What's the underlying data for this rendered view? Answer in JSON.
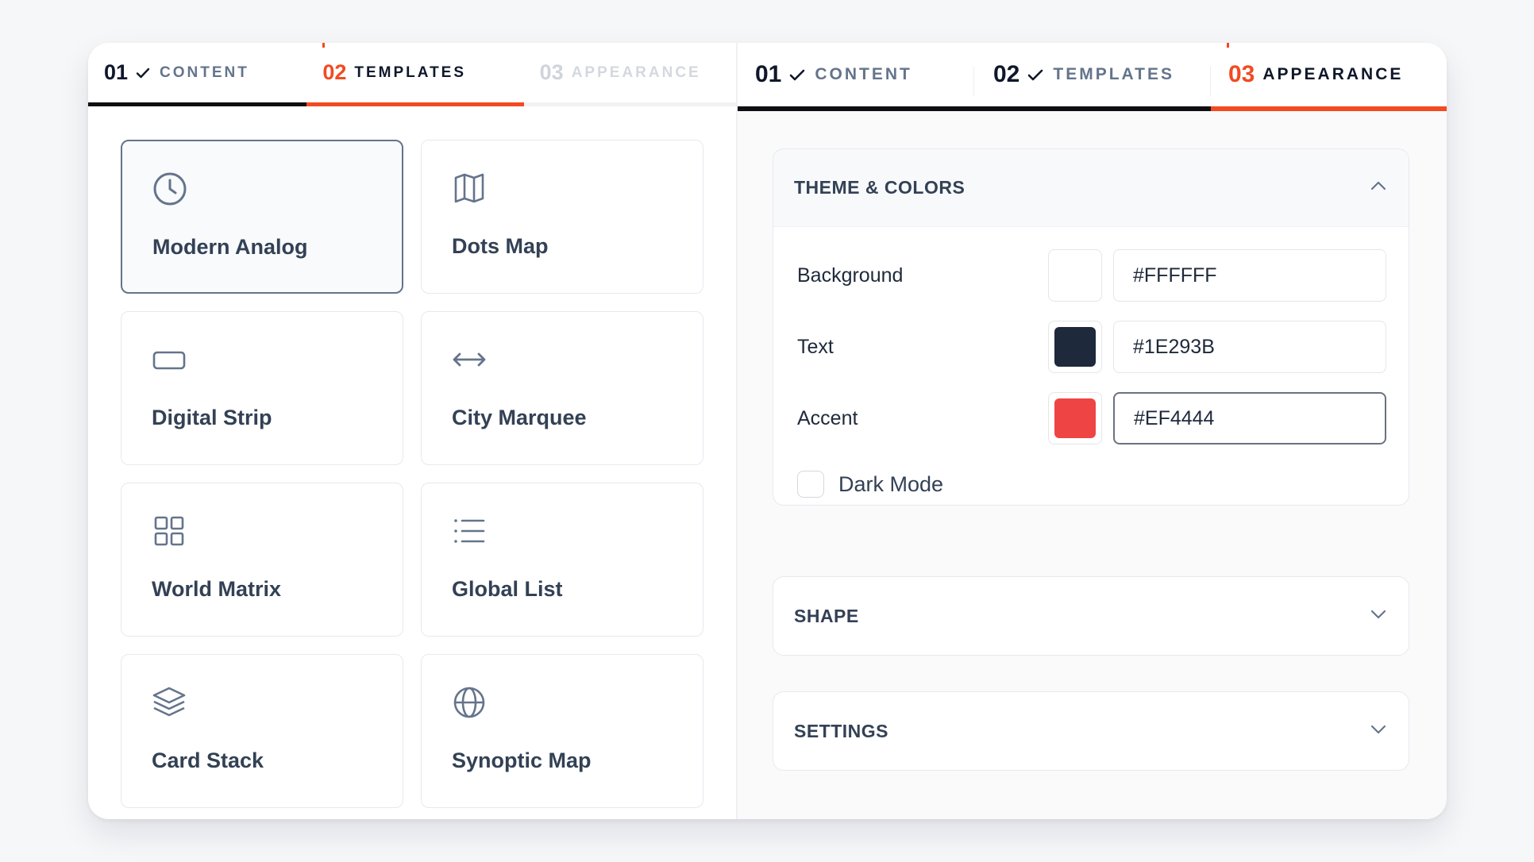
{
  "left_panel": {
    "tabs": [
      {
        "number": "01",
        "label": "CONTENT",
        "state": "done"
      },
      {
        "number": "02",
        "label": "TEMPLATES",
        "state": "active"
      },
      {
        "number": "03",
        "label": "APPEARANCE",
        "state": "pending"
      }
    ],
    "templates": [
      {
        "name": "Modern Analog",
        "icon": "clock-icon",
        "selected": true
      },
      {
        "name": "Dots Map",
        "icon": "map-icon",
        "selected": false
      },
      {
        "name": "Digital Strip",
        "icon": "rectangle-icon",
        "selected": false
      },
      {
        "name": "City Marquee",
        "icon": "arrows-horizontal-icon",
        "selected": false
      },
      {
        "name": "World Matrix",
        "icon": "grid-icon",
        "selected": false
      },
      {
        "name": "Global List",
        "icon": "list-icon",
        "selected": false
      },
      {
        "name": "Card Stack",
        "icon": "layers-icon",
        "selected": false
      },
      {
        "name": "Synoptic Map",
        "icon": "globe-icon",
        "selected": false
      }
    ]
  },
  "right_panel": {
    "tabs": [
      {
        "number": "01",
        "label": "CONTENT",
        "state": "done"
      },
      {
        "number": "02",
        "label": "TEMPLATES",
        "state": "done"
      },
      {
        "number": "03",
        "label": "APPEARANCE",
        "state": "active"
      }
    ],
    "theme": {
      "title": "THEME & COLORS",
      "colors": [
        {
          "label": "Background",
          "hex": "#FFFFFF",
          "swatch": "#ffffff"
        },
        {
          "label": "Text",
          "hex": "#1E293B",
          "swatch": "#1e293b"
        },
        {
          "label": "Accent",
          "hex": "#EF4444",
          "swatch": "#ef4444"
        }
      ],
      "dark_mode_label": "Dark Mode",
      "dark_mode_checked": false
    },
    "shape": {
      "title": "SHAPE"
    },
    "settings": {
      "title": "SETTINGS"
    }
  },
  "colors": {
    "accent": "#f24a21",
    "done_underline": "#0f0f12",
    "muted": "#64748b"
  }
}
